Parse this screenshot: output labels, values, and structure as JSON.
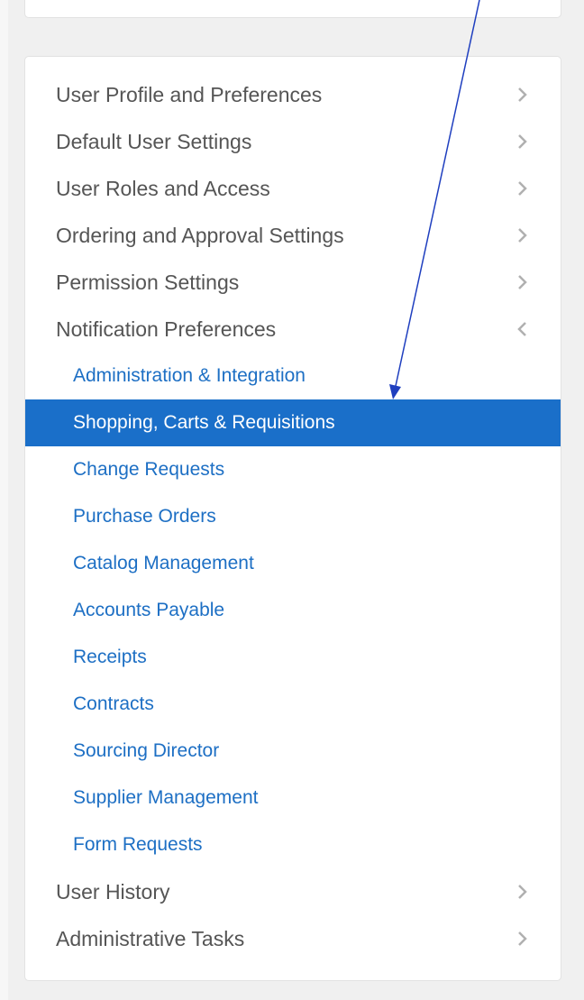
{
  "nav": {
    "items": [
      {
        "label": "User Profile and Preferences",
        "level": 0,
        "chevron": "right"
      },
      {
        "label": "Default User Settings",
        "level": 0,
        "chevron": "right"
      },
      {
        "label": "User Roles and Access",
        "level": 0,
        "chevron": "right"
      },
      {
        "label": "Ordering and Approval Settings",
        "level": 0,
        "chevron": "right"
      },
      {
        "label": "Permission Settings",
        "level": 0,
        "chevron": "right"
      },
      {
        "label": "Notification Preferences",
        "level": 0,
        "chevron": "left",
        "expanded": true
      },
      {
        "label": "Administration & Integration",
        "level": 1
      },
      {
        "label": "Shopping, Carts & Requisitions",
        "level": 1,
        "active": true
      },
      {
        "label": "Change Requests",
        "level": 1
      },
      {
        "label": "Purchase Orders",
        "level": 1
      },
      {
        "label": "Catalog Management",
        "level": 1
      },
      {
        "label": "Accounts Payable",
        "level": 1
      },
      {
        "label": "Receipts",
        "level": 1
      },
      {
        "label": "Contracts",
        "level": 1
      },
      {
        "label": "Sourcing Director",
        "level": 1
      },
      {
        "label": "Supplier Management",
        "level": 1
      },
      {
        "label": "Form Requests",
        "level": 1
      },
      {
        "label": "User History",
        "level": 0,
        "chevron": "right"
      },
      {
        "label": "Administrative Tasks",
        "level": 0,
        "chevron": "right"
      }
    ]
  },
  "colors": {
    "parent_text": "#555555",
    "child_link": "#1d6fc4",
    "active_bg": "#1a6fc9",
    "annotation_arrow": "#1f3fbf"
  },
  "annotation": {
    "type": "arrow",
    "points_to": "Shopping, Carts & Requisitions"
  }
}
